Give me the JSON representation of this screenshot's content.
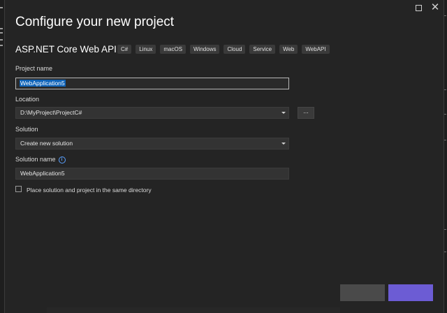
{
  "window": {
    "maximize_icon": "maximize-icon",
    "close_icon": "close-icon",
    "close_glyph": "✕"
  },
  "header": {
    "title": "Configure your new project",
    "template_name": "ASP.NET Core Web API",
    "tags": [
      "C#",
      "Linux",
      "macOS",
      "Windows",
      "Cloud",
      "Service",
      "Web",
      "WebAPI"
    ]
  },
  "form": {
    "project_name": {
      "label": "Project name",
      "value": "WebApplication5"
    },
    "location": {
      "label": "Location",
      "value": "D:\\MyProject\\ProjectC#",
      "browse_label": "..."
    },
    "solution": {
      "label": "Solution",
      "value": "Create new solution"
    },
    "solution_name": {
      "label": "Solution name",
      "value": "WebApplication5",
      "info_glyph": "i"
    },
    "same_directory": {
      "label": "Place solution and project in the same directory",
      "checked": false
    }
  },
  "colors": {
    "accent": "#6c5cd4",
    "selection": "#0e63b8",
    "background": "#242424"
  }
}
